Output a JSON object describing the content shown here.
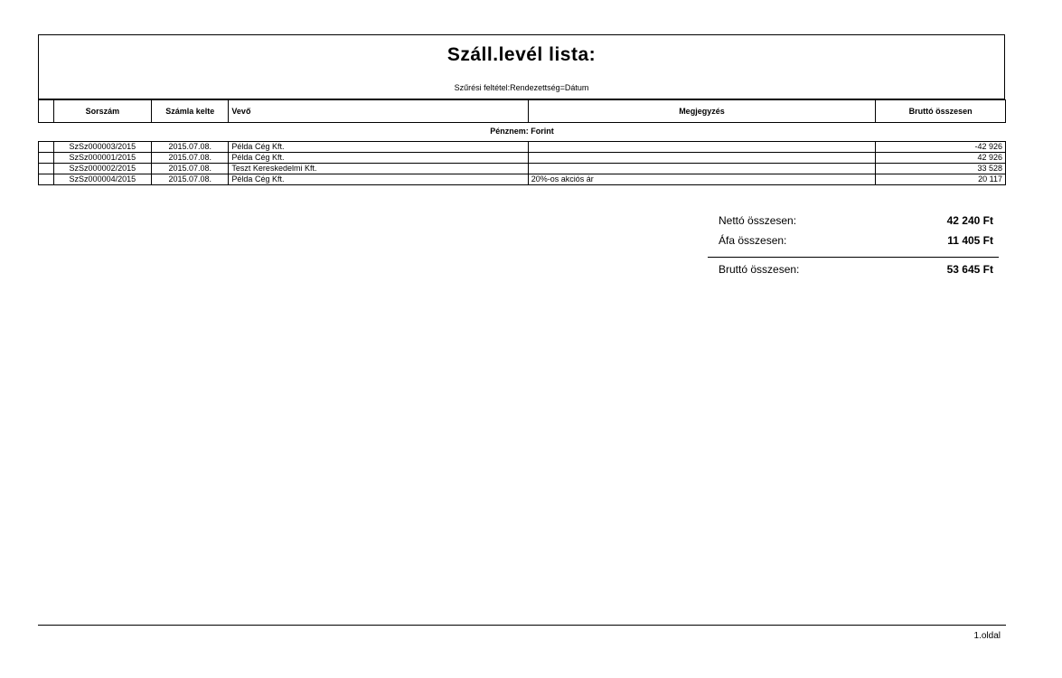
{
  "header": {
    "title": "Száll.levél lista:",
    "filter": "Szűrési feltétel:Rendezettség=Dátum"
  },
  "columns": {
    "sorszam": "Sorszám",
    "szamla_kelte": "Számla kelte",
    "vevo": "Vevő",
    "megjegyzes": "Megjegyzés",
    "brutto": "Bruttó összesen"
  },
  "currency_group": "Pénznem: Forint",
  "rows": [
    {
      "sorszam": "SzSz000003/2015",
      "datum": "2015.07.08.",
      "vevo": "Példa Cég Kft.",
      "megjegyzes": "",
      "brutto": "-42 926"
    },
    {
      "sorszam": "SzSz000001/2015",
      "datum": "2015.07.08.",
      "vevo": "Példa Cég Kft.",
      "megjegyzes": "",
      "brutto": "42 926"
    },
    {
      "sorszam": "SzSz000002/2015",
      "datum": "2015.07.08.",
      "vevo": "Teszt Kereskedelmi Kft.",
      "megjegyzes": "",
      "brutto": "33 528"
    },
    {
      "sorszam": "SzSz000004/2015",
      "datum": "2015.07.08.",
      "vevo": "Példa Cég Kft.",
      "megjegyzes": "20%-os akciós ár",
      "brutto": "20 117"
    }
  ],
  "summary": {
    "netto_label": "Nettó összesen:",
    "netto_value": "42 240 Ft",
    "afa_label": "Áfa összesen:",
    "afa_value": "11 405 Ft",
    "brutto_label": "Bruttó összesen:",
    "brutto_value": "53 645 Ft"
  },
  "footer": {
    "page": "1.oldal"
  }
}
